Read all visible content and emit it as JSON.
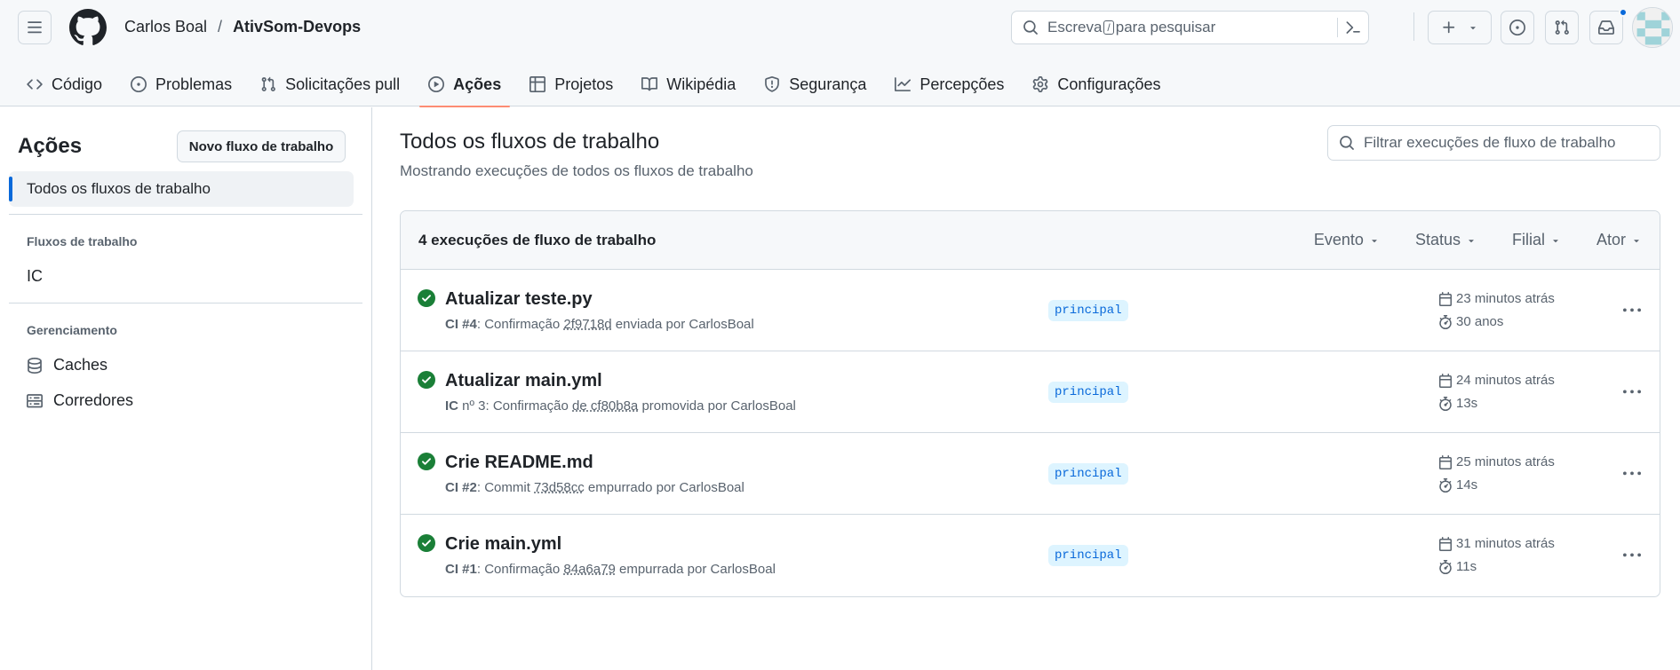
{
  "header": {
    "owner": "Carlos Boal",
    "separator": "/",
    "repo": "AtivSom-Devops",
    "search_prefix": "Escreva",
    "search_key": "/",
    "search_suffix": "para pesquisar"
  },
  "tabs": [
    {
      "label": "Código",
      "icon": "code-icon"
    },
    {
      "label": "Problemas",
      "icon": "issue-icon"
    },
    {
      "label": "Solicitações pull",
      "icon": "pull-request-icon"
    },
    {
      "label": "Ações",
      "icon": "play-icon",
      "active": true
    },
    {
      "label": "Projetos",
      "icon": "table-icon"
    },
    {
      "label": "Wikipédia",
      "icon": "book-icon"
    },
    {
      "label": "Segurança",
      "icon": "shield-icon"
    },
    {
      "label": "Percepções",
      "icon": "graph-icon"
    },
    {
      "label": "Configurações",
      "icon": "gear-icon"
    }
  ],
  "sidebar": {
    "title": "Ações",
    "new_workflow": "Novo fluxo de trabalho",
    "all_workflows": "Todos os fluxos de trabalho",
    "workflows_heading": "Fluxos de trabalho",
    "workflows": [
      "IC"
    ],
    "management_heading": "Gerenciamento",
    "management": [
      {
        "label": "Caches",
        "icon": "database-icon"
      },
      {
        "label": "Corredores",
        "icon": "server-icon"
      }
    ]
  },
  "main": {
    "title": "Todos os fluxos de trabalho",
    "subtitle": "Mostrando execuções de todos os fluxos de trabalho",
    "filter_placeholder": "Filtrar execuções de fluxo de trabalho",
    "runs_count": "4 execuções de fluxo de trabalho",
    "filters": [
      "Evento",
      "Status",
      "Filial",
      "Ator"
    ],
    "runs": [
      {
        "title": "Atualizar teste.py",
        "workflow": "CI #4",
        "meta_before": ": Confirmação ",
        "sha": "2f9718d",
        "meta_after": " enviada por CarlosBoal",
        "branch": "principal",
        "when": "23 minutos atrás",
        "duration": "30 anos",
        "status": "success"
      },
      {
        "title": "Atualizar main.yml",
        "workflow": "IC",
        "meta_before": " nº 3: Confirmação ",
        "sha": "de cf80b8a",
        "meta_after": " promovida por CarlosBoal",
        "branch": "principal",
        "when": "24 minutos atrás",
        "duration": "13s",
        "status": "success"
      },
      {
        "title": "Crie README.md",
        "workflow": "CI #2",
        "meta_before": ": Commit ",
        "sha": "73d58cc",
        "meta_after": " empurrado por CarlosBoal",
        "branch": "principal",
        "when": "25 minutos atrás",
        "duration": "14s",
        "status": "success"
      },
      {
        "title": "Crie main.yml",
        "workflow": "CI #1",
        "meta_before": ": Confirmação ",
        "sha": "84a6a79",
        "meta_after": " empurrada por CarlosBoal",
        "branch": "principal",
        "when": "31 minutos atrás",
        "duration": "11s",
        "status": "success"
      }
    ]
  },
  "colors": {
    "accent": "#0969da",
    "success": "#1a7f37",
    "tab_underline": "#fd8c73",
    "branch_bg": "#ddf4ff"
  }
}
